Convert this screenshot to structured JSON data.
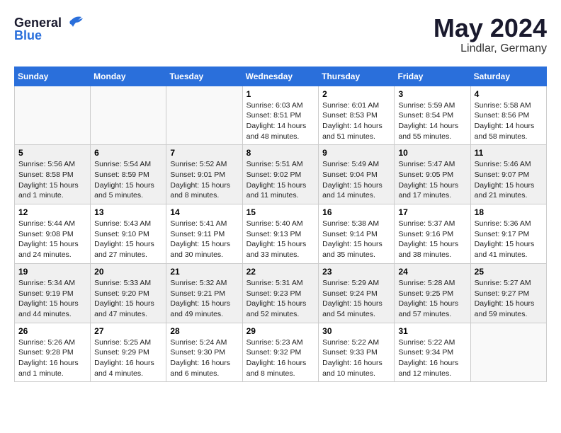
{
  "header": {
    "logo_general": "General",
    "logo_blue": "Blue",
    "month": "May 2024",
    "location": "Lindlar, Germany"
  },
  "days_of_week": [
    "Sunday",
    "Monday",
    "Tuesday",
    "Wednesday",
    "Thursday",
    "Friday",
    "Saturday"
  ],
  "weeks": [
    [
      {
        "day": "",
        "sunrise": "",
        "sunset": "",
        "daylight": ""
      },
      {
        "day": "",
        "sunrise": "",
        "sunset": "",
        "daylight": ""
      },
      {
        "day": "",
        "sunrise": "",
        "sunset": "",
        "daylight": ""
      },
      {
        "day": "1",
        "sunrise": "Sunrise: 6:03 AM",
        "sunset": "Sunset: 8:51 PM",
        "daylight": "Daylight: 14 hours and 48 minutes."
      },
      {
        "day": "2",
        "sunrise": "Sunrise: 6:01 AM",
        "sunset": "Sunset: 8:53 PM",
        "daylight": "Daylight: 14 hours and 51 minutes."
      },
      {
        "day": "3",
        "sunrise": "Sunrise: 5:59 AM",
        "sunset": "Sunset: 8:54 PM",
        "daylight": "Daylight: 14 hours and 55 minutes."
      },
      {
        "day": "4",
        "sunrise": "Sunrise: 5:58 AM",
        "sunset": "Sunset: 8:56 PM",
        "daylight": "Daylight: 14 hours and 58 minutes."
      }
    ],
    [
      {
        "day": "5",
        "sunrise": "Sunrise: 5:56 AM",
        "sunset": "Sunset: 8:58 PM",
        "daylight": "Daylight: 15 hours and 1 minute."
      },
      {
        "day": "6",
        "sunrise": "Sunrise: 5:54 AM",
        "sunset": "Sunset: 8:59 PM",
        "daylight": "Daylight: 15 hours and 5 minutes."
      },
      {
        "day": "7",
        "sunrise": "Sunrise: 5:52 AM",
        "sunset": "Sunset: 9:01 PM",
        "daylight": "Daylight: 15 hours and 8 minutes."
      },
      {
        "day": "8",
        "sunrise": "Sunrise: 5:51 AM",
        "sunset": "Sunset: 9:02 PM",
        "daylight": "Daylight: 15 hours and 11 minutes."
      },
      {
        "day": "9",
        "sunrise": "Sunrise: 5:49 AM",
        "sunset": "Sunset: 9:04 PM",
        "daylight": "Daylight: 15 hours and 14 minutes."
      },
      {
        "day": "10",
        "sunrise": "Sunrise: 5:47 AM",
        "sunset": "Sunset: 9:05 PM",
        "daylight": "Daylight: 15 hours and 17 minutes."
      },
      {
        "day": "11",
        "sunrise": "Sunrise: 5:46 AM",
        "sunset": "Sunset: 9:07 PM",
        "daylight": "Daylight: 15 hours and 21 minutes."
      }
    ],
    [
      {
        "day": "12",
        "sunrise": "Sunrise: 5:44 AM",
        "sunset": "Sunset: 9:08 PM",
        "daylight": "Daylight: 15 hours and 24 minutes."
      },
      {
        "day": "13",
        "sunrise": "Sunrise: 5:43 AM",
        "sunset": "Sunset: 9:10 PM",
        "daylight": "Daylight: 15 hours and 27 minutes."
      },
      {
        "day": "14",
        "sunrise": "Sunrise: 5:41 AM",
        "sunset": "Sunset: 9:11 PM",
        "daylight": "Daylight: 15 hours and 30 minutes."
      },
      {
        "day": "15",
        "sunrise": "Sunrise: 5:40 AM",
        "sunset": "Sunset: 9:13 PM",
        "daylight": "Daylight: 15 hours and 33 minutes."
      },
      {
        "day": "16",
        "sunrise": "Sunrise: 5:38 AM",
        "sunset": "Sunset: 9:14 PM",
        "daylight": "Daylight: 15 hours and 35 minutes."
      },
      {
        "day": "17",
        "sunrise": "Sunrise: 5:37 AM",
        "sunset": "Sunset: 9:16 PM",
        "daylight": "Daylight: 15 hours and 38 minutes."
      },
      {
        "day": "18",
        "sunrise": "Sunrise: 5:36 AM",
        "sunset": "Sunset: 9:17 PM",
        "daylight": "Daylight: 15 hours and 41 minutes."
      }
    ],
    [
      {
        "day": "19",
        "sunrise": "Sunrise: 5:34 AM",
        "sunset": "Sunset: 9:19 PM",
        "daylight": "Daylight: 15 hours and 44 minutes."
      },
      {
        "day": "20",
        "sunrise": "Sunrise: 5:33 AM",
        "sunset": "Sunset: 9:20 PM",
        "daylight": "Daylight: 15 hours and 47 minutes."
      },
      {
        "day": "21",
        "sunrise": "Sunrise: 5:32 AM",
        "sunset": "Sunset: 9:21 PM",
        "daylight": "Daylight: 15 hours and 49 minutes."
      },
      {
        "day": "22",
        "sunrise": "Sunrise: 5:31 AM",
        "sunset": "Sunset: 9:23 PM",
        "daylight": "Daylight: 15 hours and 52 minutes."
      },
      {
        "day": "23",
        "sunrise": "Sunrise: 5:29 AM",
        "sunset": "Sunset: 9:24 PM",
        "daylight": "Daylight: 15 hours and 54 minutes."
      },
      {
        "day": "24",
        "sunrise": "Sunrise: 5:28 AM",
        "sunset": "Sunset: 9:25 PM",
        "daylight": "Daylight: 15 hours and 57 minutes."
      },
      {
        "day": "25",
        "sunrise": "Sunrise: 5:27 AM",
        "sunset": "Sunset: 9:27 PM",
        "daylight": "Daylight: 15 hours and 59 minutes."
      }
    ],
    [
      {
        "day": "26",
        "sunrise": "Sunrise: 5:26 AM",
        "sunset": "Sunset: 9:28 PM",
        "daylight": "Daylight: 16 hours and 1 minute."
      },
      {
        "day": "27",
        "sunrise": "Sunrise: 5:25 AM",
        "sunset": "Sunset: 9:29 PM",
        "daylight": "Daylight: 16 hours and 4 minutes."
      },
      {
        "day": "28",
        "sunrise": "Sunrise: 5:24 AM",
        "sunset": "Sunset: 9:30 PM",
        "daylight": "Daylight: 16 hours and 6 minutes."
      },
      {
        "day": "29",
        "sunrise": "Sunrise: 5:23 AM",
        "sunset": "Sunset: 9:32 PM",
        "daylight": "Daylight: 16 hours and 8 minutes."
      },
      {
        "day": "30",
        "sunrise": "Sunrise: 5:22 AM",
        "sunset": "Sunset: 9:33 PM",
        "daylight": "Daylight: 16 hours and 10 minutes."
      },
      {
        "day": "31",
        "sunrise": "Sunrise: 5:22 AM",
        "sunset": "Sunset: 9:34 PM",
        "daylight": "Daylight: 16 hours and 12 minutes."
      },
      {
        "day": "",
        "sunrise": "",
        "sunset": "",
        "daylight": ""
      }
    ]
  ]
}
